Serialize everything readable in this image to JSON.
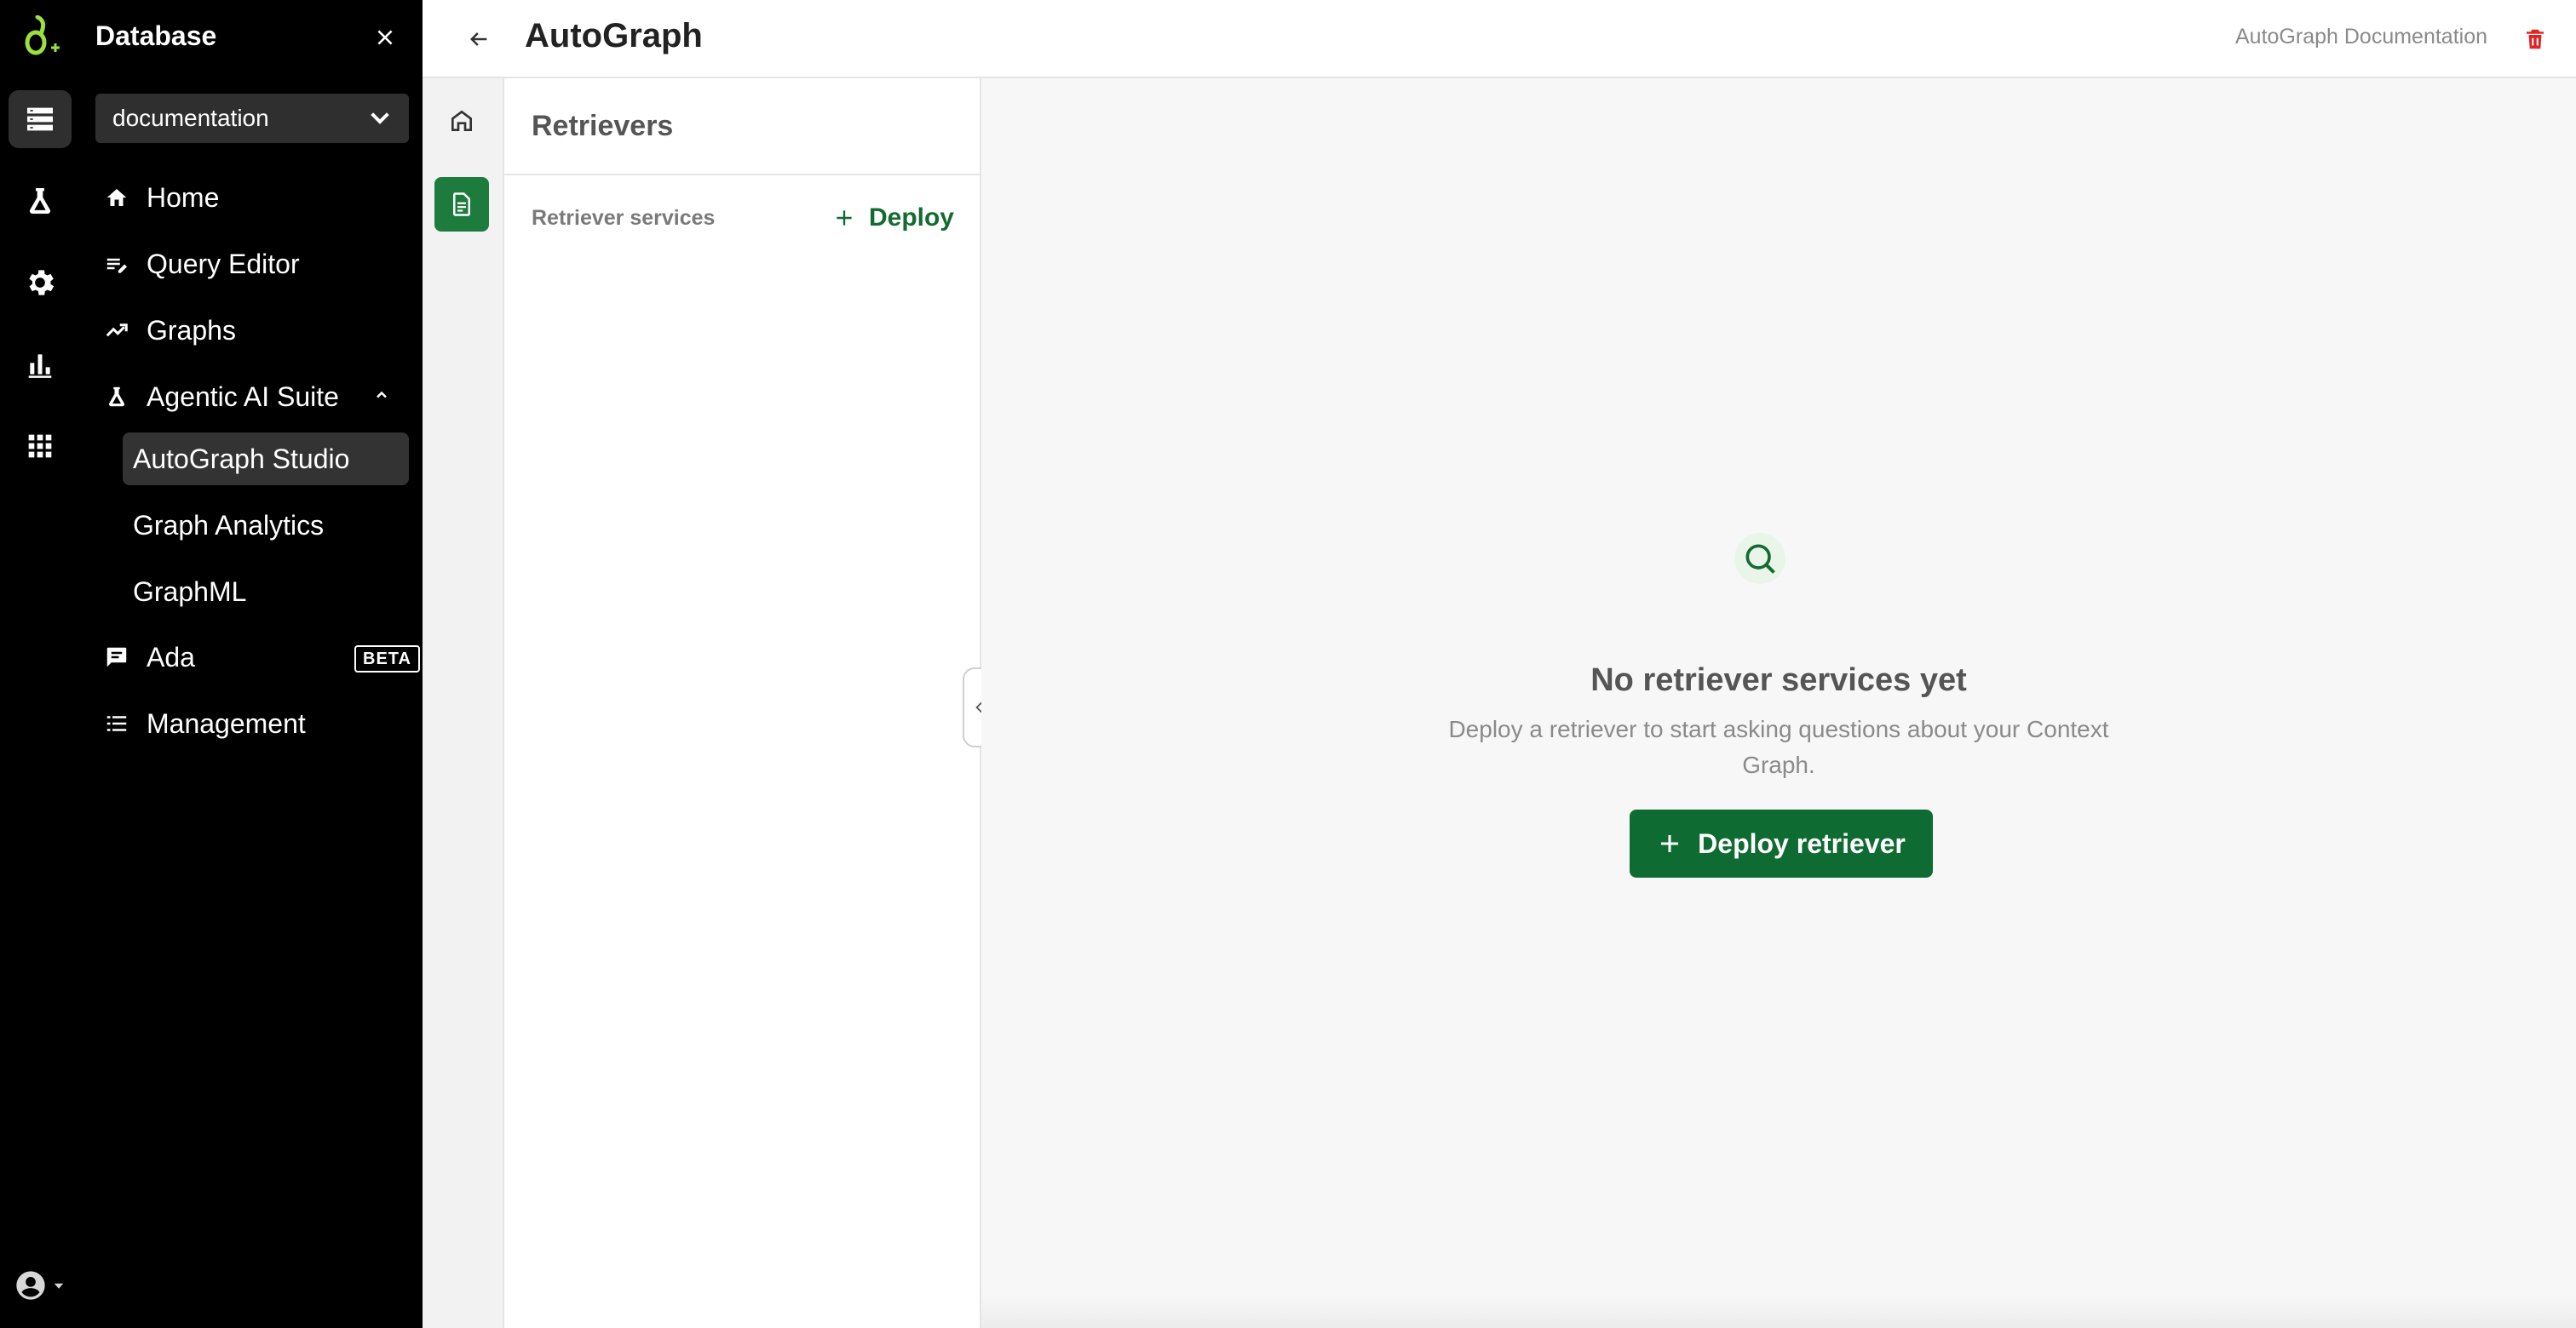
{
  "colors": {
    "brand_green": "#0e6b32",
    "logo_green": "#9be040",
    "sidebar_bg": "#000000",
    "danger_red": "#e02424"
  },
  "rail": {
    "items": [
      {
        "icon": "database-icon",
        "active": true
      },
      {
        "icon": "flask-icon",
        "active": false
      },
      {
        "icon": "gear-icon",
        "active": false
      },
      {
        "icon": "bar-chart-icon",
        "active": false
      },
      {
        "icon": "apps-grid-icon",
        "active": false
      }
    ],
    "user_icon": "account-circle-icon"
  },
  "sidebar": {
    "title": "Database",
    "database": "documentation",
    "nav": {
      "home": "Home",
      "query_editor": "Query Editor",
      "graphs": "Graphs",
      "agentic": "Agentic AI Suite",
      "autograph_studio": "AutoGraph Studio",
      "graph_analytics": "Graph Analytics",
      "graphml": "GraphML",
      "ada": "Ada",
      "ada_badge": "BETA",
      "management": "Management"
    }
  },
  "header": {
    "title": "AutoGraph",
    "doc_link": "AutoGraph Documentation"
  },
  "panel": {
    "title": "Retrievers",
    "services_label": "Retriever services",
    "deploy_label": "Deploy"
  },
  "empty_state": {
    "title": "No retriever services yet",
    "description": "Deploy a retriever to start asking questions about your Context Graph.",
    "button_label": "Deploy retriever"
  }
}
